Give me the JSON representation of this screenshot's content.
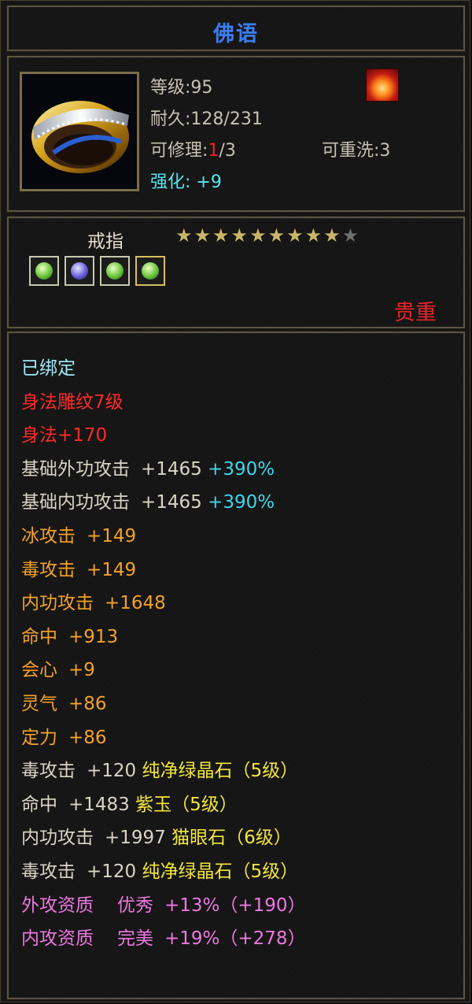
{
  "title": "佛语",
  "item": {
    "level_label": "等级:",
    "level": "95",
    "durability_label": "耐久:",
    "durability": "128/231",
    "repair_label": "可修理:",
    "repair_used": "1",
    "repair_total": "/3",
    "rewash_label": "可重洗:",
    "rewash": "3",
    "enhance_label": "强化:",
    "enhance": "+9"
  },
  "type_label": "戒指",
  "stars": {
    "filled": 9,
    "total": 10
  },
  "gems": [
    "green",
    "blue",
    "green",
    "green-gold"
  ],
  "quality": "贵重",
  "stats": {
    "bound": "已绑定",
    "carving": "身法雕纹7级",
    "carving_bonus": "身法+170",
    "ext_attack": {
      "label": "基础外功攻击",
      "value": "+1465",
      "pct": "+390%"
    },
    "int_attack": {
      "label": "基础内功攻击",
      "value": "+1465",
      "pct": "+390%"
    },
    "ice": {
      "label": "冰攻击",
      "value": "+149"
    },
    "poison": {
      "label": "毒攻击",
      "value": "+149"
    },
    "inner": {
      "label": "内功攻击",
      "value": "+1648"
    },
    "hit": {
      "label": "命中",
      "value": "+913"
    },
    "crit": {
      "label": "会心",
      "value": "+9"
    },
    "spirit": {
      "label": "灵气",
      "value": "+86"
    },
    "focus": {
      "label": "定力",
      "value": "+86"
    },
    "gem1": {
      "label": "毒攻击",
      "value": "+120",
      "gem": "纯净绿晶石（5级）"
    },
    "gem2": {
      "label": "命中",
      "value": "+1483",
      "gem": "紫玉（5级）"
    },
    "gem3": {
      "label": "内功攻击",
      "value": "+1997",
      "gem": "猫眼石（6级）"
    },
    "gem4": {
      "label": "毒攻击",
      "value": "+120",
      "gem": "纯净绿晶石（5级）"
    },
    "apt1": {
      "label": "外攻资质",
      "grade": "优秀",
      "value": "+13%（+190）"
    },
    "apt2": {
      "label": "内攻资质",
      "grade": "完美",
      "value": "+19%（+278）"
    }
  }
}
